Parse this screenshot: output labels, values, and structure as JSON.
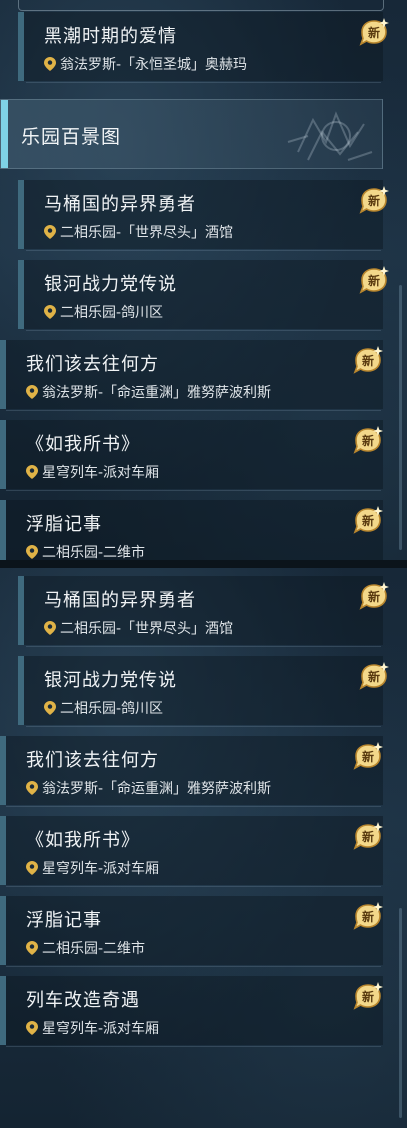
{
  "badge_text": "新",
  "colors": {
    "accent": "#7fd2e6",
    "bar": "#3f6a7e",
    "gold": "#e0b347"
  },
  "panel_top": {
    "first_item": {
      "title": "黑潮时期的爱情",
      "location": "翁法罗斯-「永恒圣城」奥赫玛"
    },
    "section_header": "乐园百景图",
    "items": [
      {
        "title": "马桶国的异界勇者",
        "location": "二相乐园-「世界尽头」酒馆"
      },
      {
        "title": "银河战力党传说",
        "location": "二相乐园-鸽川区"
      },
      {
        "title": "我们该去往何方",
        "location": "翁法罗斯-「命运重渊」雅努萨波利斯"
      },
      {
        "title": "《如我所书》",
        "location": "星穹列车-派对车厢"
      },
      {
        "title": "浮脂记事",
        "location": "二相乐园-二维市"
      }
    ]
  },
  "panel_bottom": {
    "items": [
      {
        "title": "马桶国的异界勇者",
        "location": "二相乐园-「世界尽头」酒馆"
      },
      {
        "title": "银河战力党传说",
        "location": "二相乐园-鸽川区"
      },
      {
        "title": "我们该去往何方",
        "location": "翁法罗斯-「命运重渊」雅努萨波利斯"
      },
      {
        "title": "《如我所书》",
        "location": "星穹列车-派对车厢"
      },
      {
        "title": "浮脂记事",
        "location": "二相乐园-二维市"
      },
      {
        "title": "列车改造奇遇",
        "location": "星穹列车-派对车厢"
      }
    ]
  }
}
